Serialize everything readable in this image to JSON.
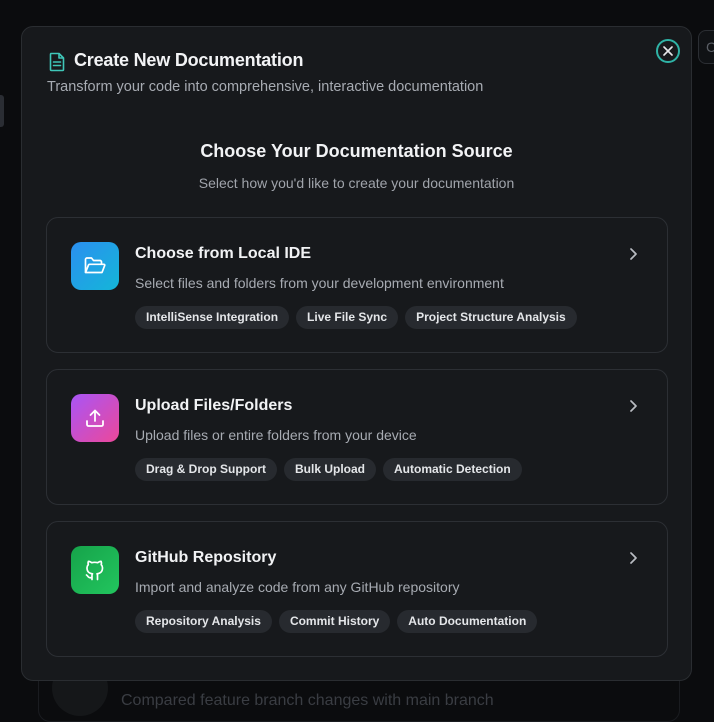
{
  "background": {
    "right_chip_glyph": "C",
    "card_text": "Compared feature branch changes with main branch"
  },
  "modal": {
    "title": "Create New Documentation",
    "subtitle": "Transform your code into comprehensive, interactive documentation",
    "section_title": "Choose Your Documentation Source",
    "section_subtitle": "Select how you'd like to create your documentation",
    "options": [
      {
        "title": "Choose from Local IDE",
        "description": "Select files and folders from your development environment",
        "icon": "folder-open-icon",
        "icon_color": "#1d9be0",
        "chips": [
          "IntelliSense Integration",
          "Live File Sync",
          "Project Structure Analysis"
        ]
      },
      {
        "title": "Upload Files/Folders",
        "description": "Upload files or entire folders from your device",
        "icon": "upload-icon",
        "icon_color": "#c04bd6",
        "chips": [
          "Drag & Drop Support",
          "Bulk Upload",
          "Automatic Detection"
        ]
      },
      {
        "title": "GitHub Repository",
        "description": "Import and analyze code from any GitHub repository",
        "icon": "github-icon",
        "icon_color": "#1fbf6a",
        "chips": [
          "Repository Analysis",
          "Commit History",
          "Auto Documentation"
        ]
      }
    ]
  },
  "colors": {
    "accent_close": "#2fb3a6",
    "ide_gradient": [
      "#2b8ff0",
      "#14b6d8"
    ],
    "upload_gradient": [
      "#a855f7",
      "#ec4899"
    ],
    "github_gradient": [
      "#16a34a",
      "#22c55e"
    ]
  }
}
